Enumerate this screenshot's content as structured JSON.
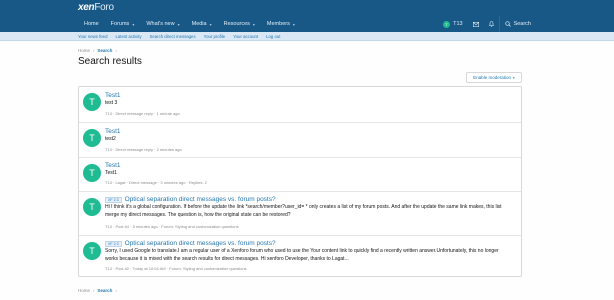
{
  "header": {
    "logo_main": "xen",
    "logo_bold": "Foro"
  },
  "nav": {
    "tabs": [
      {
        "label": "Home",
        "chevron": false
      },
      {
        "label": "Forums",
        "chevron": true
      },
      {
        "label": "What's new",
        "chevron": true
      },
      {
        "label": "Media",
        "chevron": true
      },
      {
        "label": "Resources",
        "chevron": true
      },
      {
        "label": "Members",
        "chevron": true
      }
    ],
    "user": {
      "avatar_letter": "T",
      "name": "T13"
    },
    "search_label": "Search"
  },
  "subnav": {
    "links": [
      "Your news feed",
      "Latest activity",
      "Search direct messages",
      "Your profile",
      "Your account",
      "Log out"
    ]
  },
  "breadcrumb": {
    "home": "Home",
    "current": "Search"
  },
  "page_title": "Search results",
  "moderation_button": "Enable moderation",
  "results": [
    {
      "avatar": "T",
      "title": "Test1",
      "prefix": "",
      "snippet": "test 3",
      "meta": "T13 · Direct message reply · 1 minute ago"
    },
    {
      "avatar": "T",
      "title": "Test1",
      "prefix": "",
      "snippet": "test2",
      "meta": "T13 · Direct message reply · 2 minutes ago"
    },
    {
      "avatar": "T",
      "title": "Test1",
      "prefix": "",
      "snippet": "Test1",
      "meta": "T13 · Lagat · Direct message · 3 minutes ago · Replies: 2"
    },
    {
      "avatar": "T",
      "title": "Optical separation direct messages vs. forum posts?",
      "prefix": "XF 2.3",
      "snippet": "Hi I think it's a global configuration. If before the update the link *search/member?user_id= * only creates a list of my forum posts. And after the update the same link makes, this list merge my direct messages. The question is, how the original state can be restored?",
      "meta": "T13 · Post #4 · 5 minutes ago · Forum: Styling and customization questions"
    },
    {
      "avatar": "T",
      "title": "Optical separation direct messages vs. forum posts?",
      "prefix": "XF 2.3",
      "snippet": "Sorry, I used Google to translate.I am a regular user of a Xenforo forum who used to use the Your content link to quickly find a recently written answer.Unfortunately, this no longer works because it is mixed with the search results for direct messages. Hi xenforo Developer, thanks to Lagat...",
      "meta": "T13 · Post #2 · Today at 10:04 AM · Forum: Styling and customization questions"
    }
  ],
  "breadcrumb_bottom": {
    "home": "Home",
    "current": "Search"
  }
}
